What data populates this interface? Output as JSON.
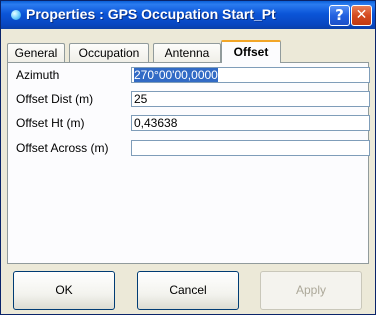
{
  "window": {
    "title": "Properties : GPS Occupation Start_Pt",
    "help_label": "?",
    "close_label": "✕"
  },
  "tabs": [
    {
      "label": "General"
    },
    {
      "label": "Occupation"
    },
    {
      "label": "Antenna"
    },
    {
      "label": "Offset"
    }
  ],
  "fields": [
    {
      "label": "Azimuth",
      "value": "270°00'00,0000"
    },
    {
      "label": "Offset Dist (m)",
      "value": "25"
    },
    {
      "label": "Offset Ht (m)",
      "value": "0,43638"
    },
    {
      "label": "Offset Across (m)",
      "value": ""
    }
  ],
  "buttons": {
    "ok": "OK",
    "cancel": "Cancel",
    "apply": "Apply"
  },
  "colors": {
    "titlebar": "#0b55d8",
    "selection": "#316ac5",
    "active_tab_accent": "#f2a628"
  }
}
